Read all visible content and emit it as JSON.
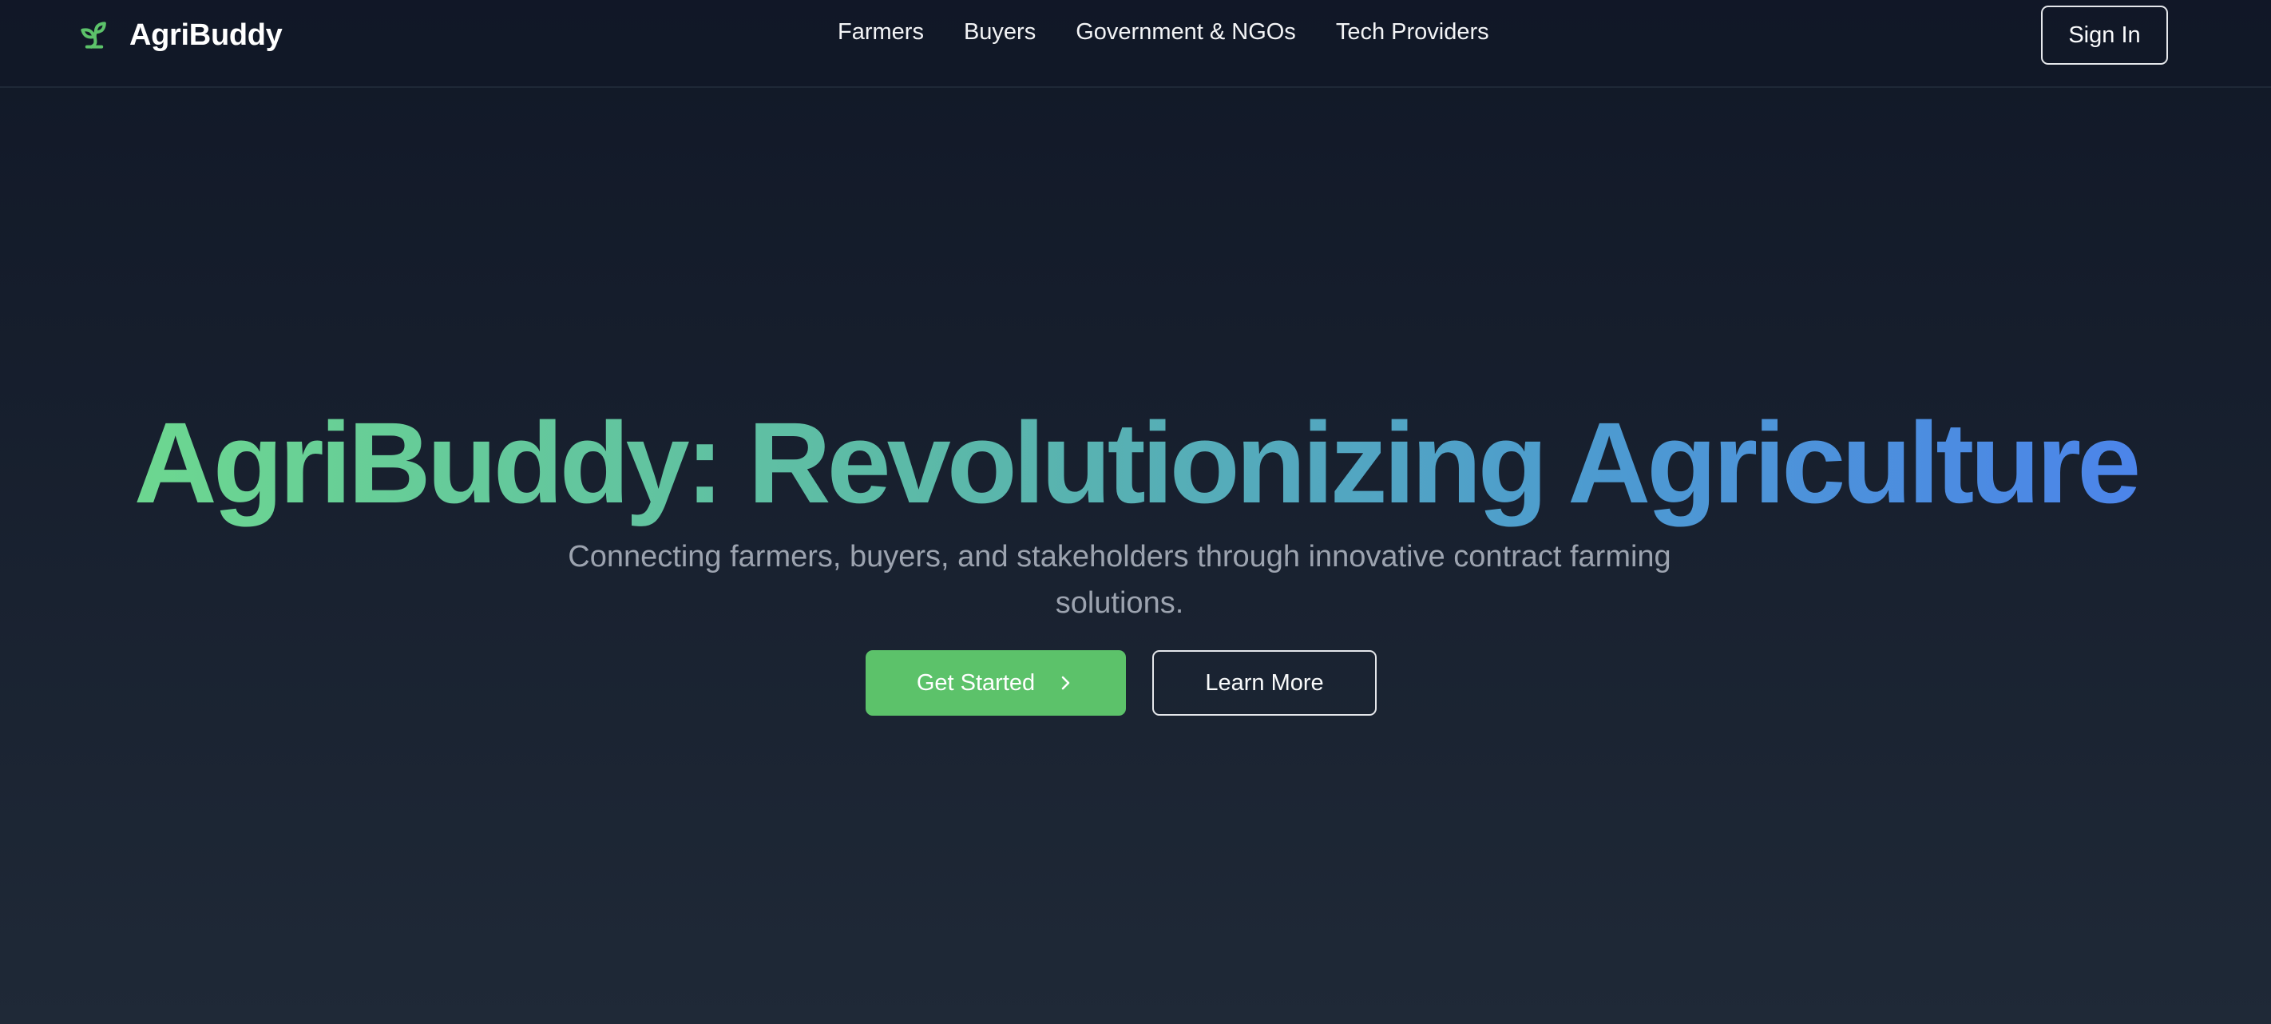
{
  "header": {
    "brand": {
      "name": "AgriBuddy",
      "icon": "sprout-icon",
      "icon_color": "#5cc26a"
    },
    "nav": [
      {
        "label": "Farmers"
      },
      {
        "label": "Buyers"
      },
      {
        "label": "Government & NGOs"
      },
      {
        "label": "Tech Providers"
      }
    ],
    "sign_in_label": "Sign In"
  },
  "hero": {
    "title": "AgriBuddy: Revolutionizing Agriculture",
    "subtitle": "Connecting farmers, buyers, and stakeholders through innovative contract farming solutions.",
    "primary_cta": {
      "label": "Get Started",
      "icon": "chevron-right-icon"
    },
    "secondary_cta": {
      "label": "Learn More"
    }
  },
  "colors": {
    "background_top": "#111827",
    "background_bottom": "#1f2937",
    "accent_green": "#5cc26a",
    "title_gradient_start": "#6fdc8c",
    "title_gradient_end": "#4c7ff0",
    "subtitle_text": "#9ca3af"
  }
}
